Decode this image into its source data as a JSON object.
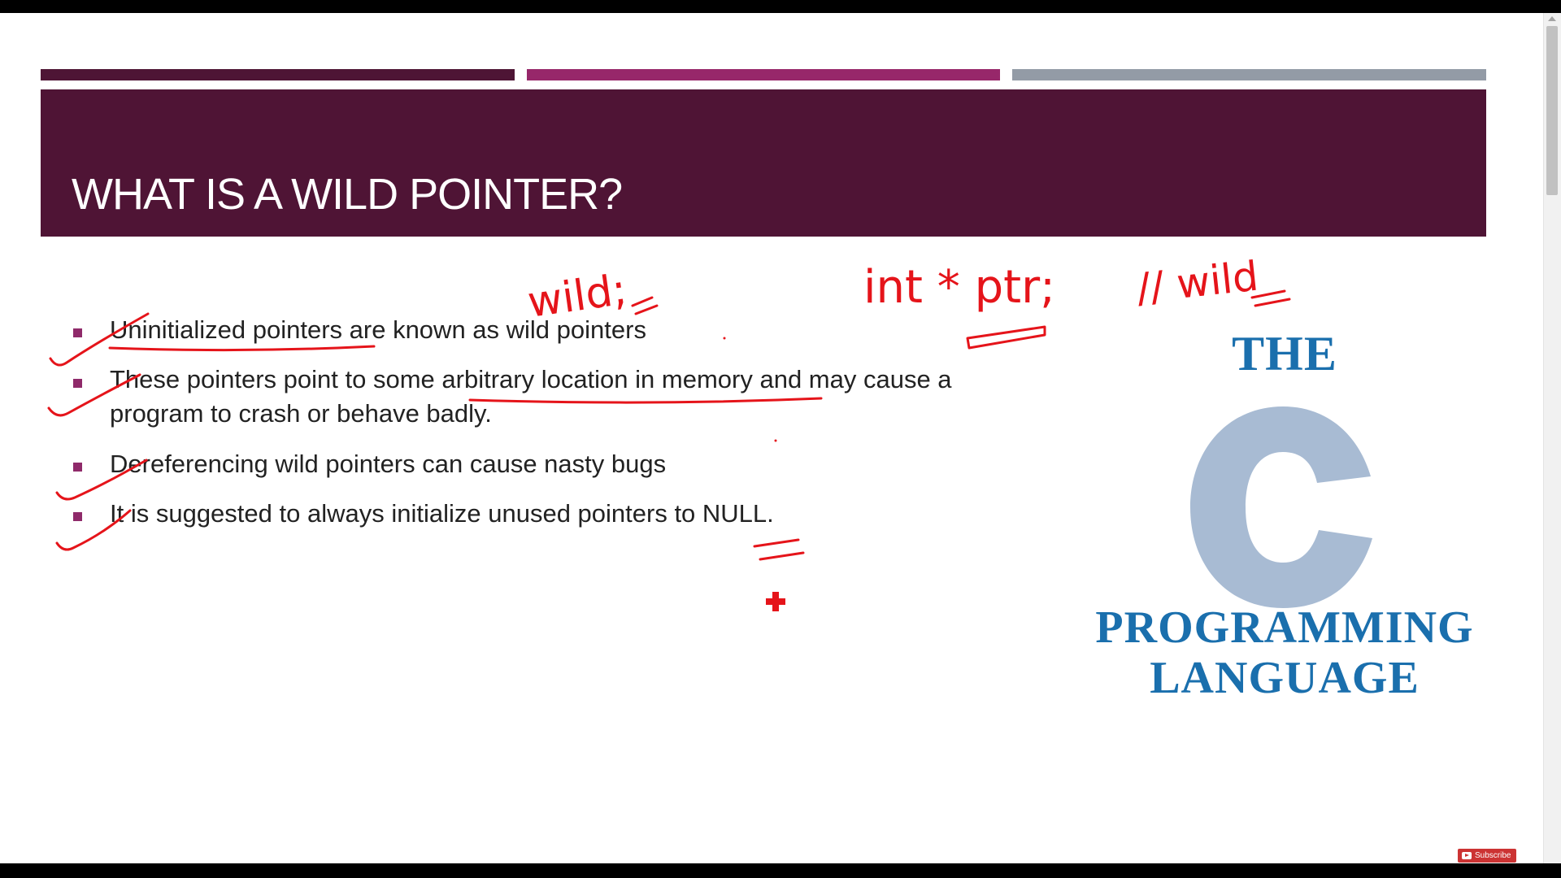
{
  "slide": {
    "title": "WHAT IS A WILD POINTER?",
    "bullets": [
      "Uninitialized pointers are known as wild pointers",
      "These pointers point to some arbitrary location in memory and may cause a program to crash or behave badly.",
      "Dereferencing wild pointers can cause nasty bugs",
      "It is suggested to always initialize unused pointers to NULL."
    ],
    "header_bar_colors": [
      "#4e1535",
      "#97276a",
      "#939ba6"
    ],
    "title_band_color": "#4f1435",
    "bullet_marker_color": "#8f2a6a"
  },
  "logo": {
    "line1": "THE",
    "letter": "C",
    "line2": "PROGRAMMING",
    "line3": "LANGUAGE",
    "text_color": "#1a6fad",
    "letter_color": "#a8bbd3"
  },
  "annotations": {
    "ink_color": "#e5141a",
    "wild_note": "wild;",
    "code_note": "int * ptr;",
    "comment_note": "// wild"
  },
  "youtube": {
    "subscribe_label": "Subscribe",
    "icon": "youtube-play-icon"
  }
}
